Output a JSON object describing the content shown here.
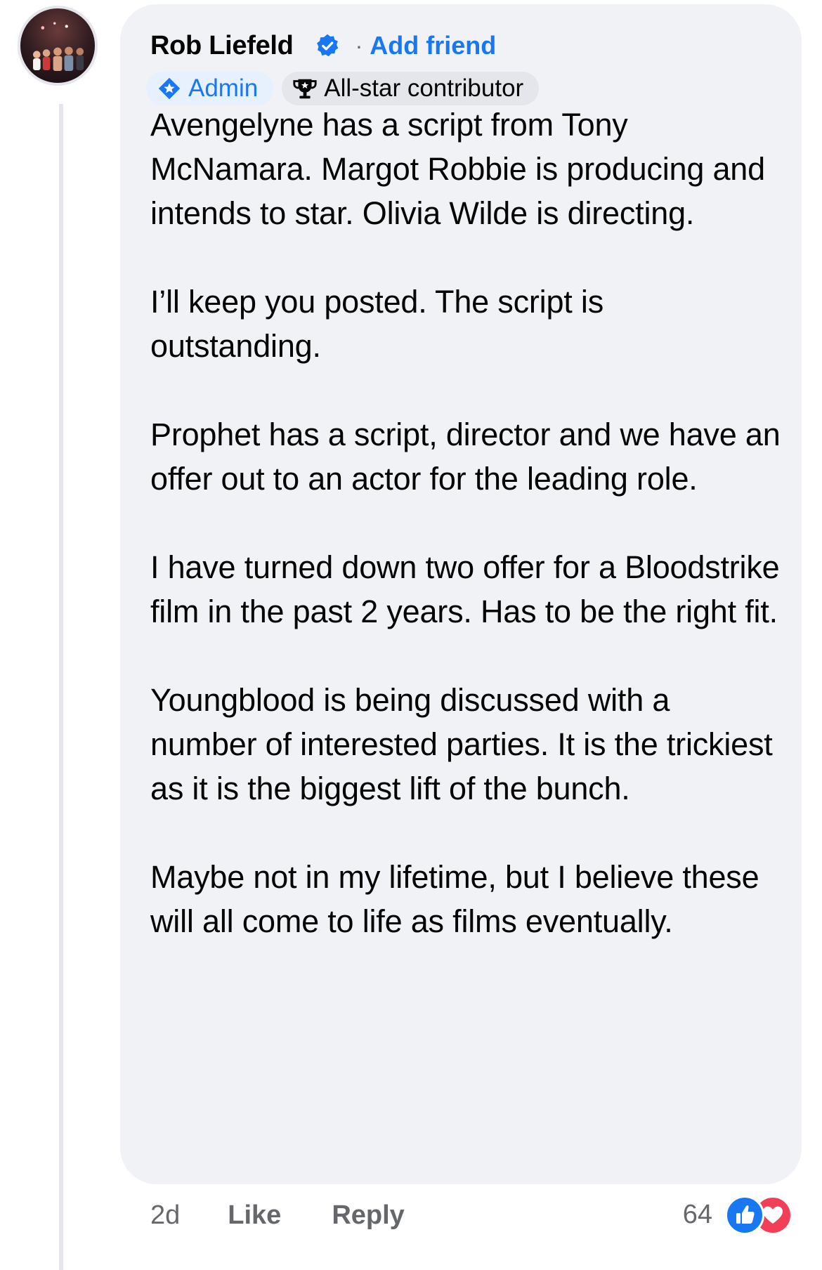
{
  "comment": {
    "author": "Rob Liefeld",
    "add_friend_label": "Add friend",
    "separator": "·",
    "badges": {
      "admin": "Admin",
      "allstar": "All-star contributor"
    },
    "paragraphs": [
      "Avengelyne has a script from Tony McNamara. Margot Robbie is producing and intends to star. Olivia Wilde is directing.",
      "I’ll keep you posted. The script is outstanding.",
      "Prophet has a script, director and we have an offer out to an actor for the leading role.",
      "I have turned down two offer for a Bloodstrike film in the past 2 years. Has to be the right fit.",
      "Youngblood is being discussed with a number of interested parties. It is the trickiest as it is the biggest lift of the bunch.",
      "Maybe not in my lifetime, but I believe these will all come to life as films eventually."
    ],
    "timestamp": "2d",
    "like_label": "Like",
    "reply_label": "Reply",
    "reaction_count": "64"
  },
  "icons": {
    "verified": "verified-badge-icon",
    "admin": "admin-shield-icon",
    "allstar": "trophy-icon",
    "like_reaction": "thumbs-up-icon",
    "love_reaction": "heart-icon"
  },
  "colors": {
    "accent": "#1877f2",
    "bubble": "#f0f2f5",
    "muted_text": "#65676b",
    "love": "#f33e58"
  }
}
